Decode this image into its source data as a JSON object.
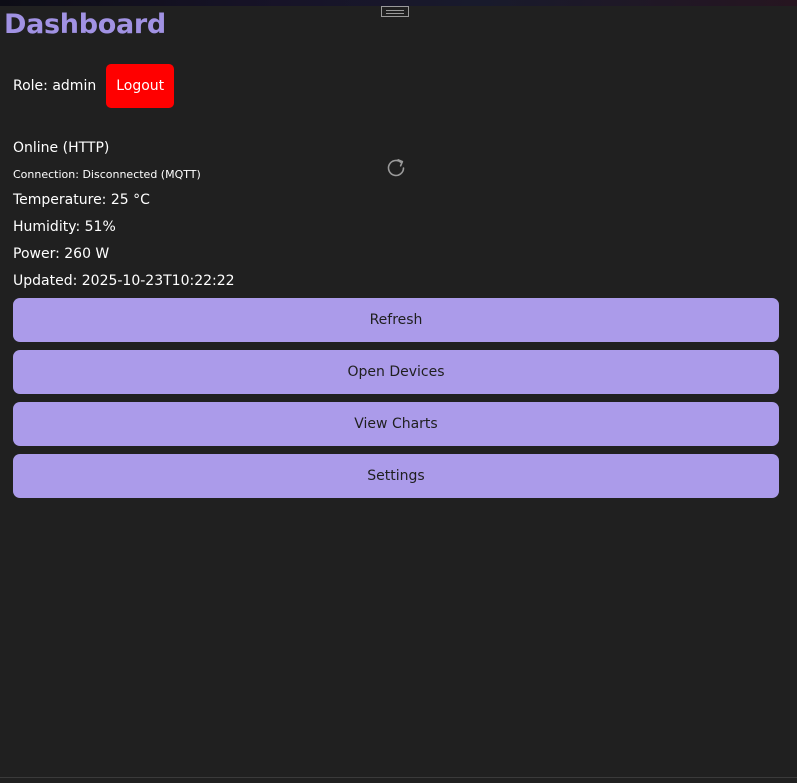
{
  "window": {
    "handle_icon": "drag-handle-icon"
  },
  "header": {
    "title": "Dashboard",
    "title_color": "#a192e3"
  },
  "user": {
    "role_text": "Role: admin",
    "logout_label": "Logout",
    "logout_color": "#ff0000"
  },
  "status": {
    "online_text": "Online (HTTP)",
    "connection_text": "Connection: Disconnected (MQTT)",
    "refresh_icon": "refresh-icon"
  },
  "readings": {
    "temperature": "Temperature: 25 °C",
    "humidity": "Humidity: 51%",
    "power": "Power: 260 W",
    "updated": "Updated: 2025-10-23T10:22:22"
  },
  "actions": {
    "button_color": "#ab9bea",
    "items": [
      {
        "label": "Refresh"
      },
      {
        "label": "Open Devices"
      },
      {
        "label": "View Charts"
      },
      {
        "label": "Settings"
      }
    ]
  }
}
